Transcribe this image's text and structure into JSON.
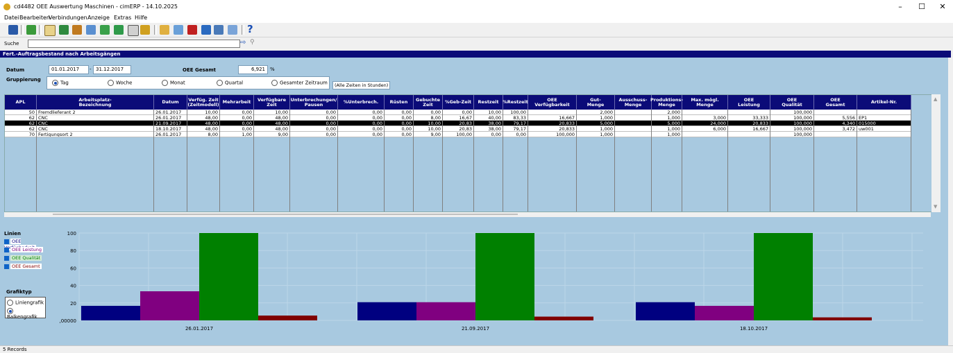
{
  "window": {
    "title": "cd4482 OEE Auswertung Maschinen - cimERP - 14.10.2025",
    "minimize": "–",
    "maximize": "☐",
    "close": "✕"
  },
  "menu": [
    "Datei",
    "Bearbeiten",
    "Verbindungen",
    "Anzeige",
    "Extras",
    "Hilfe"
  ],
  "search": {
    "label": "Suche",
    "value": ""
  },
  "panel_title": "Fert.-Auftragsbestand nach Arbeitsgängen",
  "filter": {
    "datum_label": "Datum",
    "date_from": "01.01.2017",
    "date_sep": "-",
    "date_to": "31.12.2017",
    "oee_label": "OEE Gesamt",
    "oee_value": "6,921",
    "oee_unit": "%",
    "gruppierung_label": "Gruppierung",
    "options": [
      "Tag",
      "Woche",
      "Monat",
      "Quartal",
      "Gesamter Zeitraum"
    ],
    "selected": "Tag",
    "note": "(Alle Zeiten in Stunden)"
  },
  "table": {
    "headers": [
      "APL",
      "Arbeitsplatz-\nBezeichnung",
      "Datum",
      "Verfüg. Zeit\n(Zeitmodell)",
      "Mehrarbeit",
      "Verfügbare\nZeit",
      "Unterbrechungen/\nPausen",
      "%Unterbrech.",
      "Rüsten",
      "Gebuchte\nZeit",
      "%Geb-Zeit",
      "Restzeit",
      "%Restzeit",
      "OEE\nVerfügbarkeit",
      "Gut-\nMenge",
      "Ausschuss-\nMenge",
      "Produktions-\nMenge",
      "Max. mögl.\nMenge",
      "OEE\nLeistung",
      "OEE\nQualität",
      "OEE\nGesamt",
      "Artikel-Nr."
    ],
    "rows": [
      [
        "50",
        "Fremdlieferant 2",
        "26.01.2017",
        "10,00",
        "0,00",
        "10,00",
        "0,00",
        "0,00",
        "0,00",
        "0,00",
        "0,00",
        "10,00",
        "100,00",
        "",
        "2,000",
        "",
        "2,000",
        "",
        "",
        "100,000",
        "",
        ""
      ],
      [
        "62",
        "CNC",
        "26.01.2017",
        "48,00",
        "0,00",
        "48,00",
        "0,00",
        "0,00",
        "0,00",
        "8,00",
        "16,67",
        "40,00",
        "83,33",
        "16,667",
        "1,000",
        "",
        "1,000",
        "3,000",
        "33,333",
        "100,000",
        "5,556",
        "EP1"
      ],
      [
        "62",
        "CNC",
        "21.09.2017",
        "48,00",
        "0,00",
        "48,00",
        "0,00",
        "0,00",
        "0,00",
        "10,00",
        "20,83",
        "38,00",
        "79,17",
        "20,833",
        "5,000",
        "",
        "5,000",
        "24,000",
        "20,833",
        "100,000",
        "4,340",
        "015000"
      ],
      [
        "62",
        "CNC",
        "18.10.2017",
        "48,00",
        "0,00",
        "48,00",
        "0,00",
        "0,00",
        "0,00",
        "10,00",
        "20,83",
        "38,00",
        "79,17",
        "20,833",
        "1,000",
        "",
        "1,000",
        "6,000",
        "16,667",
        "100,000",
        "3,472",
        "uw001"
      ],
      [
        "70",
        "Fertigungsort 2",
        "26.01.2017",
        "8,00",
        "1,00",
        "9,00",
        "0,00",
        "0,00",
        "0,00",
        "9,00",
        "100,00",
        "0,00",
        "0,00",
        "100,000",
        "1,000",
        "",
        "1,000",
        "",
        "",
        "100,000",
        "",
        ""
      ]
    ],
    "selected_row": 2
  },
  "legend": {
    "title": "Linien",
    "items": [
      {
        "label": "OEE Verfügbarkeit",
        "color": "#000080"
      },
      {
        "label": "OEE Leistung",
        "color": "#800080"
      },
      {
        "label": "OEE Qualität",
        "color": "#008000"
      },
      {
        "label": "OEE Gesamt",
        "color": "#800000"
      }
    ]
  },
  "graph_type": {
    "title": "Grafiktyp",
    "options": [
      "Liniengrafik",
      "Balkengrafik"
    ],
    "selected": "Balkengrafik"
  },
  "chart_data": {
    "type": "bar",
    "categories": [
      "26.01.2017",
      "21.09.2017",
      "18.10.2017"
    ],
    "series": [
      {
        "name": "OEE Verfügbarkeit",
        "color": "#000080",
        "values": [
          16.667,
          20.833,
          20.833
        ]
      },
      {
        "name": "OEE Leistung",
        "color": "#800080",
        "values": [
          33.333,
          20.833,
          16.667
        ]
      },
      {
        "name": "OEE Qualität",
        "color": "#008000",
        "values": [
          100,
          100,
          100
        ]
      },
      {
        "name": "OEE Gesamt",
        "color": "#800000",
        "values": [
          5.556,
          4.34,
          3.472
        ]
      }
    ],
    "yticks": [
      ",00000",
      "20",
      "40",
      "60",
      "80",
      "100"
    ],
    "ylim": [
      0,
      100
    ],
    "grid": true
  },
  "status": "5 Records"
}
